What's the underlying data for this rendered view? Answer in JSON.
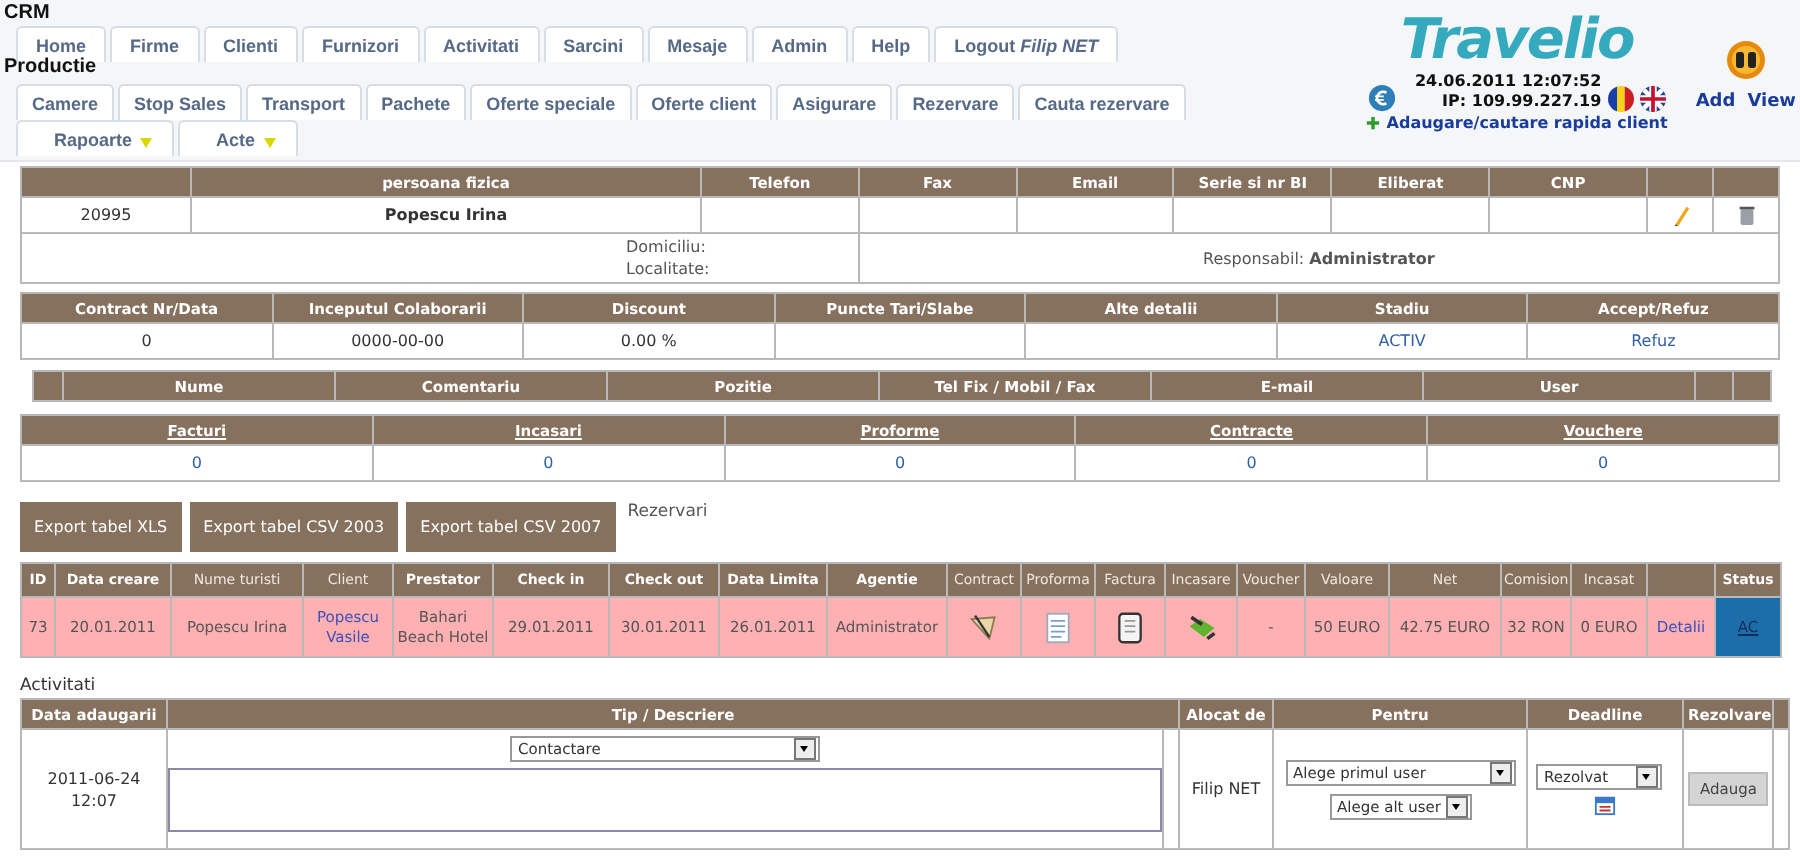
{
  "app": {
    "title": "CRM",
    "section": "Productie"
  },
  "main_tabs": [
    {
      "label": "Home"
    },
    {
      "label": "Firme"
    },
    {
      "label": "Clienti"
    },
    {
      "label": "Furnizori"
    },
    {
      "label": "Activitati"
    },
    {
      "label": "Sarcini"
    },
    {
      "label": "Mesaje"
    },
    {
      "label": "Admin"
    },
    {
      "label": "Help"
    },
    {
      "label": "Logout *Filip NET*"
    }
  ],
  "sub_tabs": [
    {
      "label": "Camere",
      "has_menu": false
    },
    {
      "label": "Stop Sales",
      "has_menu": false
    },
    {
      "label": "Transport",
      "has_menu": false
    },
    {
      "label": "Pachete",
      "has_menu": false
    },
    {
      "label": "Oferte speciale",
      "has_menu": false
    },
    {
      "label": "Oferte client",
      "has_menu": false
    },
    {
      "label": "Asigurare",
      "has_menu": false
    },
    {
      "label": "Rezervare",
      "has_menu": false
    },
    {
      "label": "Cauta rezervare",
      "has_menu": false
    },
    {
      "label": "Rapoarte",
      "has_menu": true
    },
    {
      "label": "Acte",
      "has_menu": true
    }
  ],
  "header": {
    "logo": "Travelio",
    "datetime": "24.06.2011 12:07:52",
    "ip": "IP: 109.99.227.19",
    "quick_link": "Adaugare/cautare rapida client",
    "actions": [
      "Add",
      "View"
    ]
  },
  "client_table": {
    "columns": [
      {},
      {
        "label": "persoana fizica"
      },
      {
        "label": "Telefon"
      },
      {
        "label": "Fax"
      },
      {
        "label": "Email"
      },
      {
        "label": "Serie si nr BI"
      },
      {
        "label": "Eliberat"
      },
      {
        "label": "CNP"
      },
      {},
      {}
    ],
    "id": "20995",
    "name": "Popescu Irina",
    "address_labels": [
      "Domiciliu:",
      "Localitate:"
    ],
    "responsible": "Responsabil: **Administrator**"
  },
  "contract_table": {
    "columns": [
      "Contract Nr/Data",
      "Inceputul Colaborarii",
      "Discount",
      "Puncte Tari/Slabe",
      "Alte detalii",
      "Stadiu",
      "Accept/Refuz"
    ],
    "contract": "0",
    "start": "0000-00-00",
    "discount": "0.00 %",
    "stage": "ACTIV",
    "action": "Refuz"
  },
  "contacts_table": {
    "columns": [
      "Nume",
      "Comentariu",
      "Pozitie",
      "Tel Fix / Mobil / Fax",
      "E-mail",
      "User"
    ]
  },
  "documents_summary": [
    {
      "label": "Facturi",
      "count": "0"
    },
    {
      "label": "Incasari",
      "count": "0"
    },
    {
      "label": "Proforme",
      "count": "0"
    },
    {
      "label": "Contracte",
      "count": "0"
    },
    {
      "label": "Vouchere",
      "count": "0"
    }
  ],
  "export_buttons": [
    "Export tabel XLS",
    "Export tabel CSV 2003",
    "Export tabel CSV 2007"
  ],
  "reservations": {
    "title": "Rezervari",
    "columns": [
      {
        "label": "ID",
        "bold": true
      },
      {
        "label": "Data creare",
        "bold": true
      },
      {
        "label": "Nume turisti",
        "bold": false
      },
      {
        "label": "Client",
        "bold": false
      },
      {
        "label": "Prestator",
        "bold": true
      },
      {
        "label": "Check in",
        "bold": true
      },
      {
        "label": "Check out",
        "bold": true
      },
      {
        "label": "Data Limita",
        "bold": true
      },
      {
        "label": "Agentie",
        "bold": true
      },
      {
        "label": "Contract",
        "bold": false
      },
      {
        "label": "Proforma",
        "bold": false
      },
      {
        "label": "Factura",
        "bold": false
      },
      {
        "label": "Incasare",
        "bold": false
      },
      {
        "label": "Voucher",
        "bold": false
      },
      {
        "label": "Valoare",
        "bold": false
      },
      {
        "label": "Net",
        "bold": false
      },
      {
        "label": "Comision",
        "bold": false
      },
      {
        "label": "Incasat",
        "bold": false
      },
      {},
      {
        "label": "Status",
        "bold": true
      }
    ],
    "rows": [
      {
        "id": "73",
        "created": "20.01.2011",
        "tourists": "Popescu Irina",
        "client": "Popescu Vasile",
        "provider": "Bahari Beach Hotel",
        "check_in": "29.01.2011",
        "check_out": "30.01.2011",
        "deadline": "26.01.2011",
        "agency": "Administrator",
        "voucher": "-",
        "value": "50 EURO",
        "net": "42.75 EURO",
        "commission": "32 RON",
        "collected": "0 EURO",
        "details": "Detalii",
        "status": "AC"
      }
    ]
  },
  "activities": {
    "title": "Activitati",
    "columns": [
      "Data adaugarii",
      "Tip / Descriere",
      "Alocat de",
      "Pentru",
      "Deadline",
      "Rezolvare"
    ],
    "rows": [
      {
        "date": "2011-06-24 12:07",
        "type": "Contactare",
        "allocated_by": "Filip NET",
        "for_selects": [
          "Alege primul user",
          "Alege alt user"
        ],
        "deadline": "Rezolvat",
        "button": "Adauga",
        "button_disabled": true
      }
    ]
  }
}
